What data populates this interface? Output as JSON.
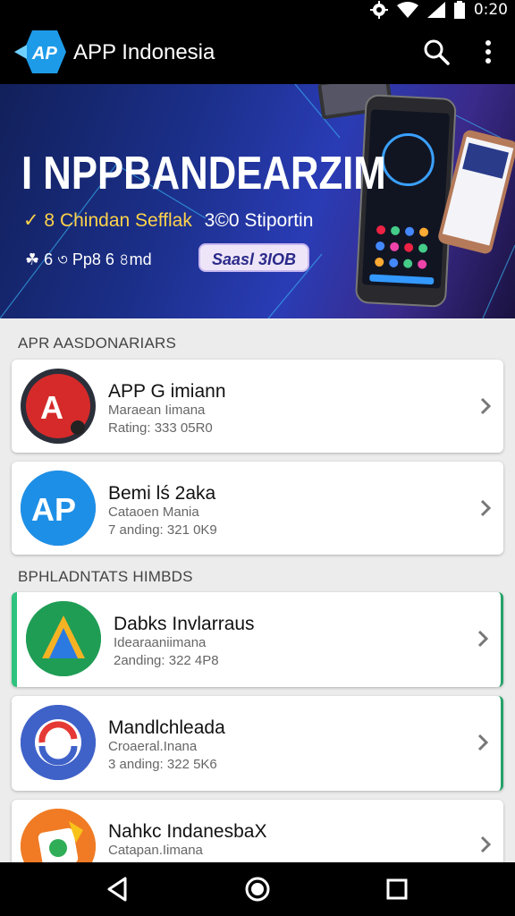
{
  "status_bar": {
    "time": "0:20",
    "icons": [
      "settings-icon",
      "wifi-icon",
      "signal-icon",
      "battery-icon"
    ]
  },
  "app_bar": {
    "title": "APP Indonesia",
    "logo_text": "AP",
    "actions": [
      "search-icon",
      "more-vert-icon"
    ]
  },
  "banner": {
    "title": "I NPPBANDEARZIM",
    "subtitle_prefix": "✓ 8 Chindan Sefflak",
    "subtitle_suffix": "3©0 Stiportin",
    "rating": "☘ 6 ৩ Pp8 6 ৪md",
    "button": "Saasl 3IOB"
  },
  "sections": [
    {
      "title": "APR AASDONARIARS",
      "items": [
        {
          "name": "APP G imiann",
          "line1": "Maraean Iimana",
          "line2": "Rating: 333 05R0",
          "icon": "ap-red-logo-icon"
        },
        {
          "name": "Bemi lś 2aka",
          "line1": "Cataoen Mania",
          "line2": "7 anding: 321 0K9",
          "icon": "ap-blue-logo-icon"
        }
      ]
    },
    {
      "title": "BPHLADNTATS HIMBDS",
      "items": [
        {
          "name": "Dabks Invlarraus",
          "line1": "Idearaaniimana",
          "line2": "2anding: 322 4P8",
          "icon": "triangle-logo-icon"
        },
        {
          "name": "Mandlchleada",
          "line1": "Croaeral.Inana",
          "line2": "3 anding: 322 5K6",
          "icon": "circle-logo-icon"
        },
        {
          "name": "Nahkc IndanesbaX",
          "line1": "Catapan.Iimana",
          "line2": "",
          "icon": "orange-logo-icon"
        }
      ]
    }
  ],
  "nav_bar": {
    "buttons": [
      "back-icon",
      "home-icon",
      "recents-icon"
    ]
  },
  "colors": {
    "accent_green": "#2ec27e",
    "banner_yellow": "#ffd34a",
    "app_bar": "#000000"
  }
}
